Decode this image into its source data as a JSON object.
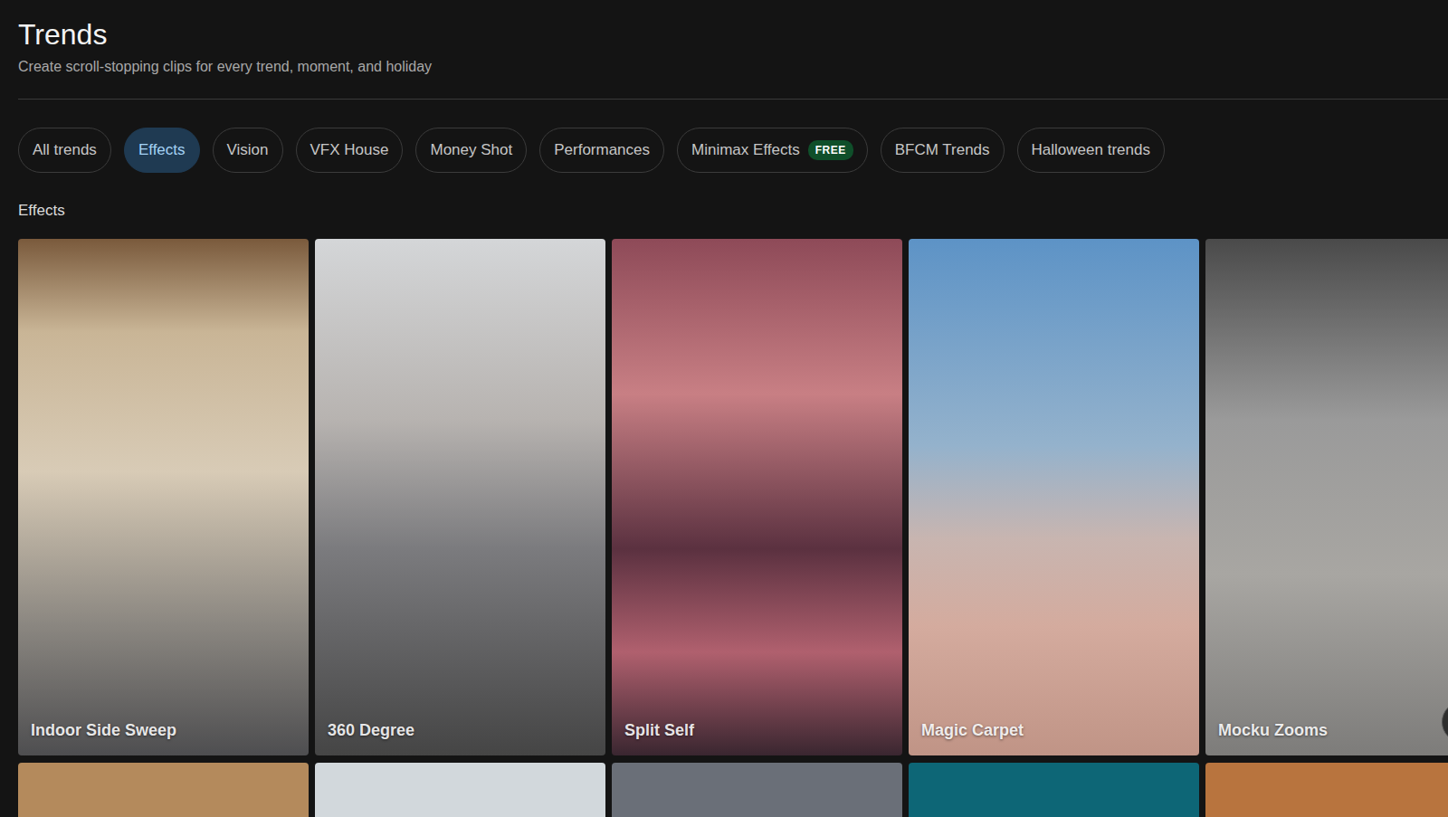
{
  "page": {
    "title": "Trends",
    "subtitle": "Create scroll-stopping clips for every trend, moment, and holiday"
  },
  "tabs": [
    {
      "label": "All trends",
      "selected": false
    },
    {
      "label": "Effects",
      "selected": true
    },
    {
      "label": "Vision",
      "selected": false
    },
    {
      "label": "VFX House",
      "selected": false
    },
    {
      "label": "Money Shot",
      "selected": false
    },
    {
      "label": "Performances",
      "selected": false
    },
    {
      "label": "Minimax Effects",
      "selected": false,
      "badge": "FREE"
    },
    {
      "label": "BFCM Trends",
      "selected": false
    },
    {
      "label": "Halloween trends",
      "selected": false
    }
  ],
  "section": {
    "title": "Effects"
  },
  "cards": [
    {
      "title": "Indoor Side Sweep"
    },
    {
      "title": "360 Degree"
    },
    {
      "title": "Split Self"
    },
    {
      "title": "Magic Carpet"
    },
    {
      "title": "Mocku Zooms"
    }
  ]
}
